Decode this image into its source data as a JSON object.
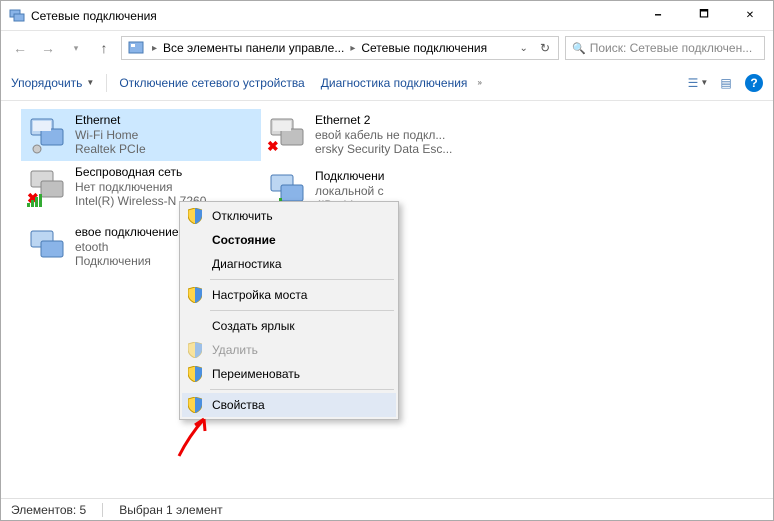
{
  "title": "Сетевые подключения",
  "breadcrumb": {
    "item1": "Все элементы панели управле...",
    "item2": "Сетевые подключения"
  },
  "search_placeholder": "Поиск: Сетевые подключен...",
  "toolbar": {
    "organize": "Упорядочить",
    "disable": "Отключение сетевого устройства",
    "diagnose": "Диагностика подключения"
  },
  "connections": [
    {
      "name": "Ethernet",
      "status": "Wi-Fi Home",
      "device": "Realtek PCIe"
    },
    {
      "name": "Ethernet 2",
      "status": "евой кабель не подкл...",
      "device": "ersky Security Data Esc..."
    },
    {
      "name": "Беспроводная сеть",
      "status": "Нет подключения",
      "device": "Intel(R) Wireless-N 7260"
    },
    {
      "name": "Подключени",
      "status": "локальной с",
      "device": "4iDroid.com"
    },
    {
      "name": "евое подключение",
      "status": "etooth",
      "device": "Подключения"
    }
  ],
  "context_menu": {
    "disable": "Отключить",
    "status": "Состояние",
    "diagnose": "Диагностика",
    "bridge": "Настройка моста",
    "shortcut": "Создать ярлык",
    "delete": "Удалить",
    "rename": "Переименовать",
    "properties": "Свойства"
  },
  "statusbar": {
    "elements": "Элементов: 5",
    "selected": "Выбран 1 элемент"
  }
}
